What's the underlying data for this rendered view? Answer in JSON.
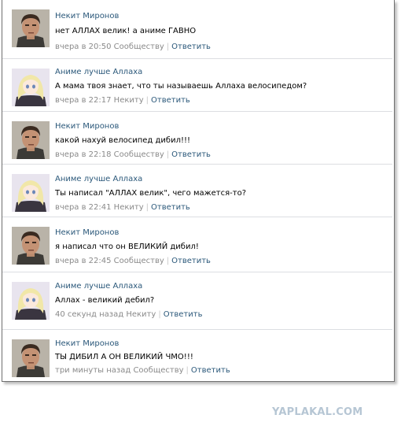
{
  "comments": [
    {
      "author": "Некит Миронов",
      "text": "нет АЛЛАХ велик! а аниме ГАВНО",
      "meta": "вчера в 20:50 Сообществу",
      "reply": "Ответить",
      "avatar": "man-avatar"
    },
    {
      "author": "Аниме лучше Аллаха",
      "text": "А мама твоя знает, что ты называешь Аллаха велосипедом?",
      "meta": "вчера в 22:17 Некиту",
      "reply": "Ответить",
      "avatar": "anime-avatar"
    },
    {
      "author": "Некит Миронов",
      "text": "какой нахуй велосипед дибил!!!",
      "meta": "вчера в 22:18 Сообществу",
      "reply": "Ответить",
      "avatar": "man-avatar"
    },
    {
      "author": "Аниме лучше Аллаха",
      "text": "Ты написал \"АЛЛАХ велик\", чего мажется-то?",
      "meta": "вчера в 22:41 Некиту",
      "reply": "Ответить",
      "avatar": "anime-avatar"
    },
    {
      "author": "Некит Миронов",
      "text": "я написал что он ВЕЛИКИЙ дибил!",
      "meta": "вчера в 22:45 Сообществу",
      "reply": "Ответить",
      "avatar": "man-avatar"
    },
    {
      "author": "Аниме лучше Аллаха",
      "text": "Аллах - великий дебил?",
      "meta": "40 секунд назад Некиту",
      "reply": "Ответить",
      "avatar": "anime-avatar"
    },
    {
      "author": "Некит Миронов",
      "text": "ТЫ ДИБИЛ А ОН ВЕЛИКИЙ ЧМО!!!",
      "meta": "три минуты назад Сообществу",
      "reply": "Ответить",
      "avatar": "man-avatar"
    }
  ],
  "watermark": "YAPLAKAL.COM",
  "colors": {
    "link": "#2b587a",
    "meta": "#8a8a8a",
    "divider": "#dcdee2",
    "watermark": "#b6c6d4"
  }
}
